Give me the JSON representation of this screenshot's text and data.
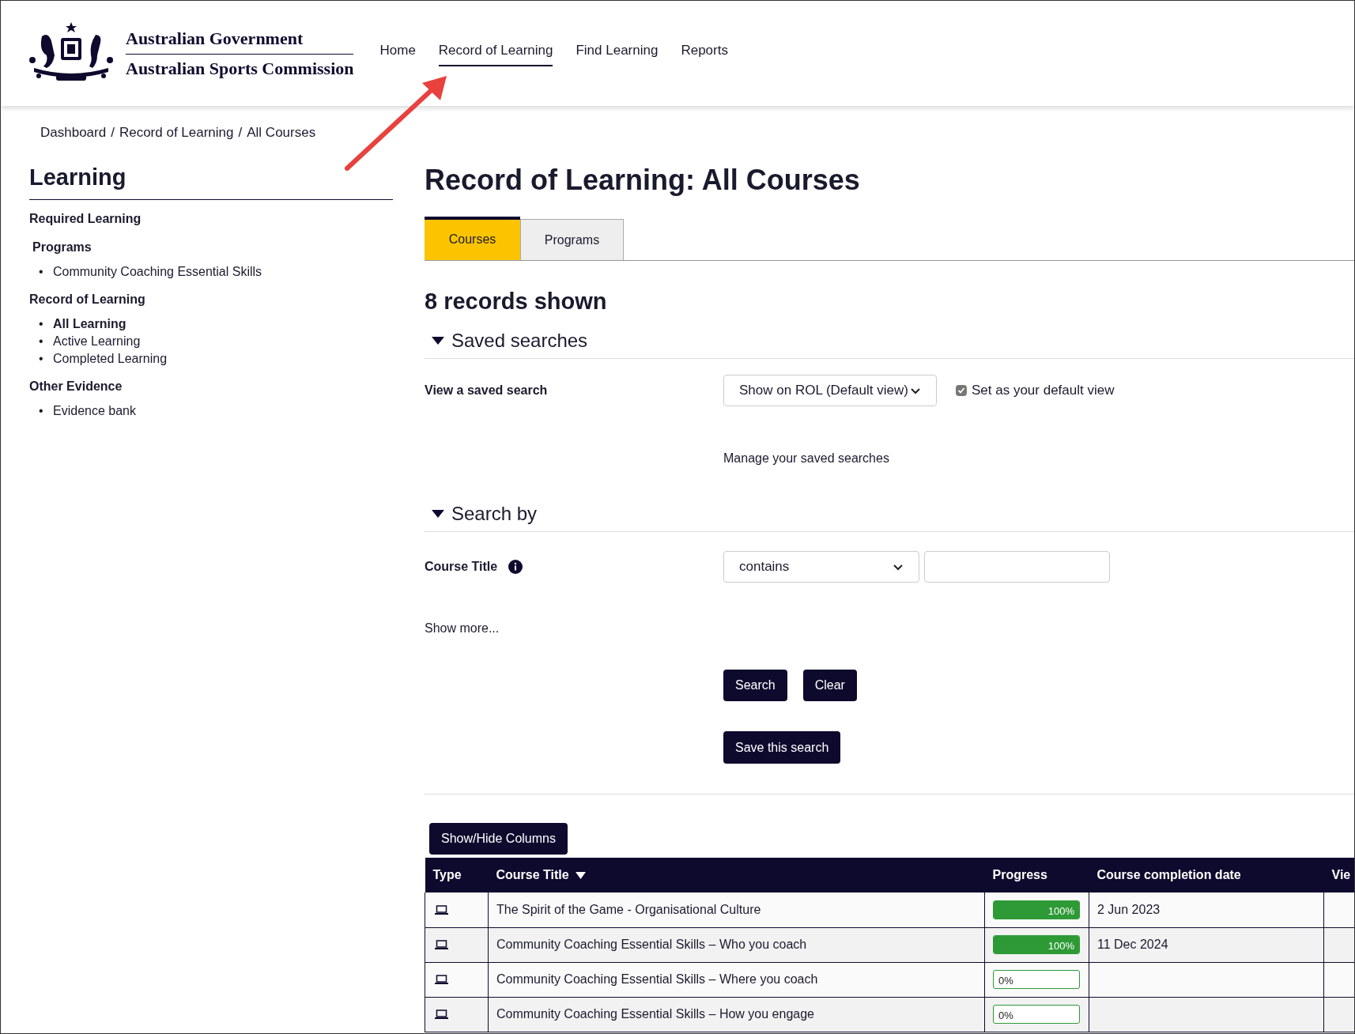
{
  "header": {
    "logo_lines": [
      "Australian Government",
      "Australian Sports Commission"
    ],
    "nav": [
      {
        "label": "Home",
        "selected": false
      },
      {
        "label": "Record of Learning",
        "selected": true
      },
      {
        "label": "Find Learning",
        "selected": false
      },
      {
        "label": "Reports",
        "selected": false
      }
    ]
  },
  "breadcrumb": {
    "items": [
      "Dashboard",
      "Record of Learning",
      "All Courses"
    ],
    "separator": "/"
  },
  "sidebar": {
    "title": "Learning",
    "bullet": "•",
    "sections": [
      {
        "heading": "Required Learning"
      },
      {
        "heading": "Programs",
        "items": [
          {
            "label": "Community Coaching Essential Skills",
            "selected": false
          }
        ]
      },
      {
        "heading": "Record of Learning",
        "items": [
          {
            "label": "All Learning",
            "selected": true
          },
          {
            "label": "Active Learning",
            "selected": false
          },
          {
            "label": "Completed Learning",
            "selected": false
          }
        ]
      },
      {
        "heading": "Other Evidence",
        "items": [
          {
            "label": "Evidence bank",
            "selected": false
          }
        ]
      }
    ]
  },
  "page_title": "Record of Learning: All Courses",
  "tabs": [
    {
      "label": "Courses",
      "selected": true
    },
    {
      "label": "Programs",
      "selected": false
    }
  ],
  "records_count": "8 records shown",
  "saved_searches": {
    "heading": "Saved searches",
    "expanded": true,
    "label": "View a saved search",
    "select_value": "Show on ROL (Default view)",
    "default_checkbox": {
      "label": "Set as your default view",
      "checked": true
    },
    "manage_link": "Manage your saved searches"
  },
  "search_by": {
    "heading": "Search by",
    "expanded": true,
    "field_label": "Course Title",
    "operator": "contains",
    "show_more": "Show more...",
    "buttons": [
      "Search",
      "Clear"
    ],
    "save_button": "Save this search"
  },
  "table": {
    "toggle_button": "Show/Hide Columns",
    "columns": [
      "Type",
      "Course Title",
      "Progress",
      "Course completion date",
      "Vie"
    ],
    "rows": [
      {
        "title": "The Spirit of the Game - Organisational Culture",
        "progress": {
          "level": 1,
          "reading": "100%"
        },
        "completion_date": "2 Jun 2023"
      },
      {
        "title": "Community Coaching Essential Skills – Who you coach",
        "progress": {
          "level": 1,
          "reading": "100%"
        },
        "completion_date": "11 Dec 2024"
      },
      {
        "title": "Community Coaching Essential Skills – Where you coach",
        "progress": {
          "level": 0,
          "reading": "0%"
        },
        "completion_date": ""
      },
      {
        "title": "Community Coaching Essential Skills – How you engage",
        "progress": {
          "level": 0,
          "reading": "0%"
        },
        "completion_date": ""
      }
    ]
  }
}
